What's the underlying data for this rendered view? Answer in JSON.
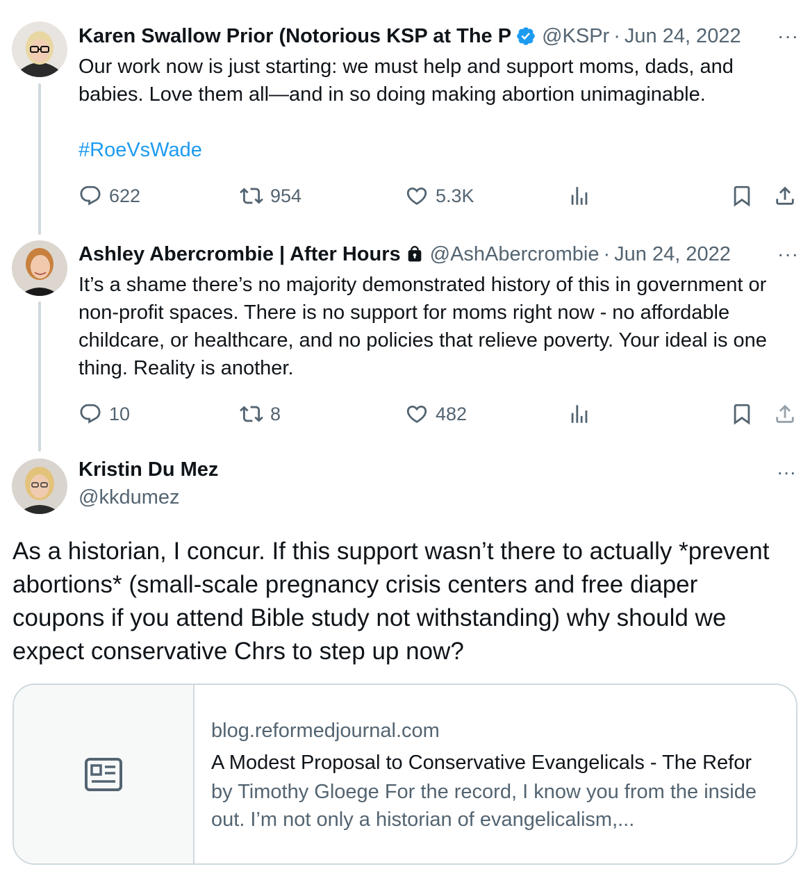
{
  "tweets": [
    {
      "name": "Karen Swallow Prior (Notorious KSP at The P",
      "verified": true,
      "handle": "@KSPr",
      "date": "Jun 24, 2022",
      "text": "Our work now is just starting: we must help and support moms, dads, and babies. Love them all—and in so doing making abortion unimaginable.",
      "hashtag": "#RoeVsWade",
      "replies": "622",
      "retweets": "954",
      "likes": "5.3K"
    },
    {
      "name": "Ashley Abercrombie | After Hours",
      "locked": true,
      "handle": "@AshAbercrombie",
      "date": "Jun 24, 2022",
      "text": "It’s a shame there’s no majority demonstrated history of this in government or non-profit spaces. There is no support for moms right now - no affordable childcare, or healthcare, and no policies that relieve poverty. Your ideal is one thing. Reality is another.",
      "replies": "10",
      "retweets": "8",
      "likes": "482"
    }
  ],
  "main_tweet": {
    "name": "Kristin Du Mez",
    "handle": "@kkdumez",
    "text": "As a historian, I concur. If this support wasn’t there to actually *prevent abortions* (small-scale pregnancy crisis centers and free diaper coupons if you attend Bible study not withstanding) why should we expect conservative Chrs to step up now?"
  },
  "link_card": {
    "domain": "blog.reformedjournal.com",
    "title": "A Modest Proposal to Conservative Evangelicals - The Refor",
    "description": "by Timothy Gloege For the record, I know you from the inside out. I’m not only a historian of evangelicalism,..."
  },
  "more_label": "···",
  "separator": "·",
  "colors": {
    "accent": "#1d9bf0",
    "secondary_text": "#536471",
    "border": "#cfd9de"
  }
}
